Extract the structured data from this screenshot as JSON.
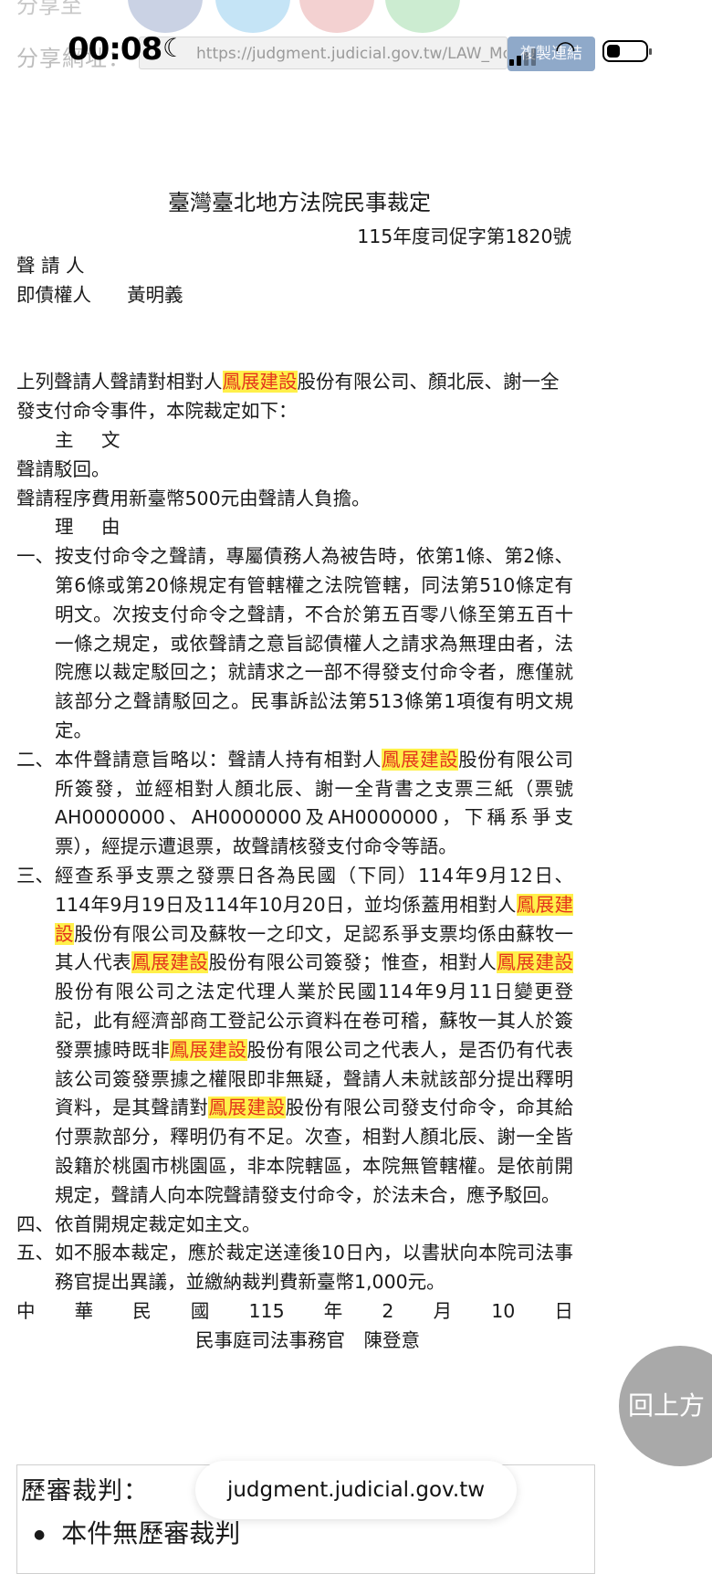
{
  "overlay": {
    "share_label_top": "分享至",
    "share_label": "分享網址：",
    "time": "00:08",
    "url": "https://judgment.judicial.gov.tw/LAW_Mobile_FJUD",
    "copy_button": "複製連結",
    "domain_pill": "judgment.judicial.gov.tw",
    "back_to_top": "回上方"
  },
  "doc": {
    "court_title": "臺灣臺北地方法院民事裁定",
    "case_no": "115年度司促字第1820號",
    "applicant_label": "聲 請 人",
    "creditor_label": "即債權人",
    "creditor_name": "黃明義",
    "intro_a": "上列聲請人聲請對相對人",
    "company": "鳳展建設",
    "intro_b": "股份有限公司、顏北辰、謝一全發支付命令事件，本院裁定如下：",
    "main_heading": "主 文",
    "main_1": "聲請駁回。",
    "main_2": "聲請程序費用新臺幣500元由聲請人負擔。",
    "reason_heading": "理 由",
    "r1_num": "一、",
    "r1": "按支付命令之聲請，專屬債務人為被告時，依第1條、第2條、第6條或第20條規定有管轄權之法院管轄，同法第510條定有明文。次按支付命令之聲請，不合於第五百零八條至第五百十一條之規定，或依聲請之意旨認債權人之請求為無理由者，法院應以裁定駁回之；就請求之一部不得發支付命令者，應僅就該部分之聲請駁回之。民事訴訟法第513條第1項復有明文規定。",
    "r2_num": "二、",
    "r2_a": "本件聲請意旨略以：聲請人持有相對人",
    "r2_b": "股份有限公司所簽發，並經相對人顏北辰、謝一全背書之支票三紙（票號AH0000000、AH0000000及AH0000000，下稱系爭支票），經提示遭退票，故聲請核發支付命令等語。",
    "r3_num": "三、",
    "r3_a": "經查系爭支票之發票日各為民國（下同）114年9月12日、114年9月19日及114年10月20日，並均係蓋用相對人",
    "r3_b": "股份有限公司及蘇牧一之印文，足認系爭支票均係由蘇牧一其人代表",
    "r3_c": "股份有限公司簽發；惟查，相對人",
    "r3_d": "股份有限公司之法定代理人業於民國114年9月11日變更登記，此有經濟部商工登記公示資料在卷可稽，蘇牧一其人於簽發票據時既非",
    "r3_e": "股份有限公司之代表人，是否仍有代表該公司簽發票據之權限即非無疑，聲請人未就該部分提出釋明資料，是其聲請對",
    "r3_f": "股份有限公司發支付命令，命其給付票款部分，釋明仍有不足。次查，相對人顏北辰、謝一全皆設籍於桃園市桃園區，非本院轄區，本院無管轄權。是依前開規定，聲請人向本院聲請發支付命令，於法未合，應予駁回。",
    "r4_num": "四、",
    "r4": "依首開規定裁定如主文。",
    "r5_num": "五、",
    "r5": "如不服本裁定，應於裁定送達後10日內，以書狀向本院司法事務官提出異議，並繳納裁判費新臺幣1,000元。",
    "date": [
      "中",
      "華",
      "民",
      "國",
      "115",
      "年",
      "2",
      "月",
      "10",
      "日"
    ],
    "signature": "民事庭司法事務官　陳登意"
  },
  "history": {
    "title": "歷審裁判：",
    "item": "本件無歷審裁判"
  }
}
